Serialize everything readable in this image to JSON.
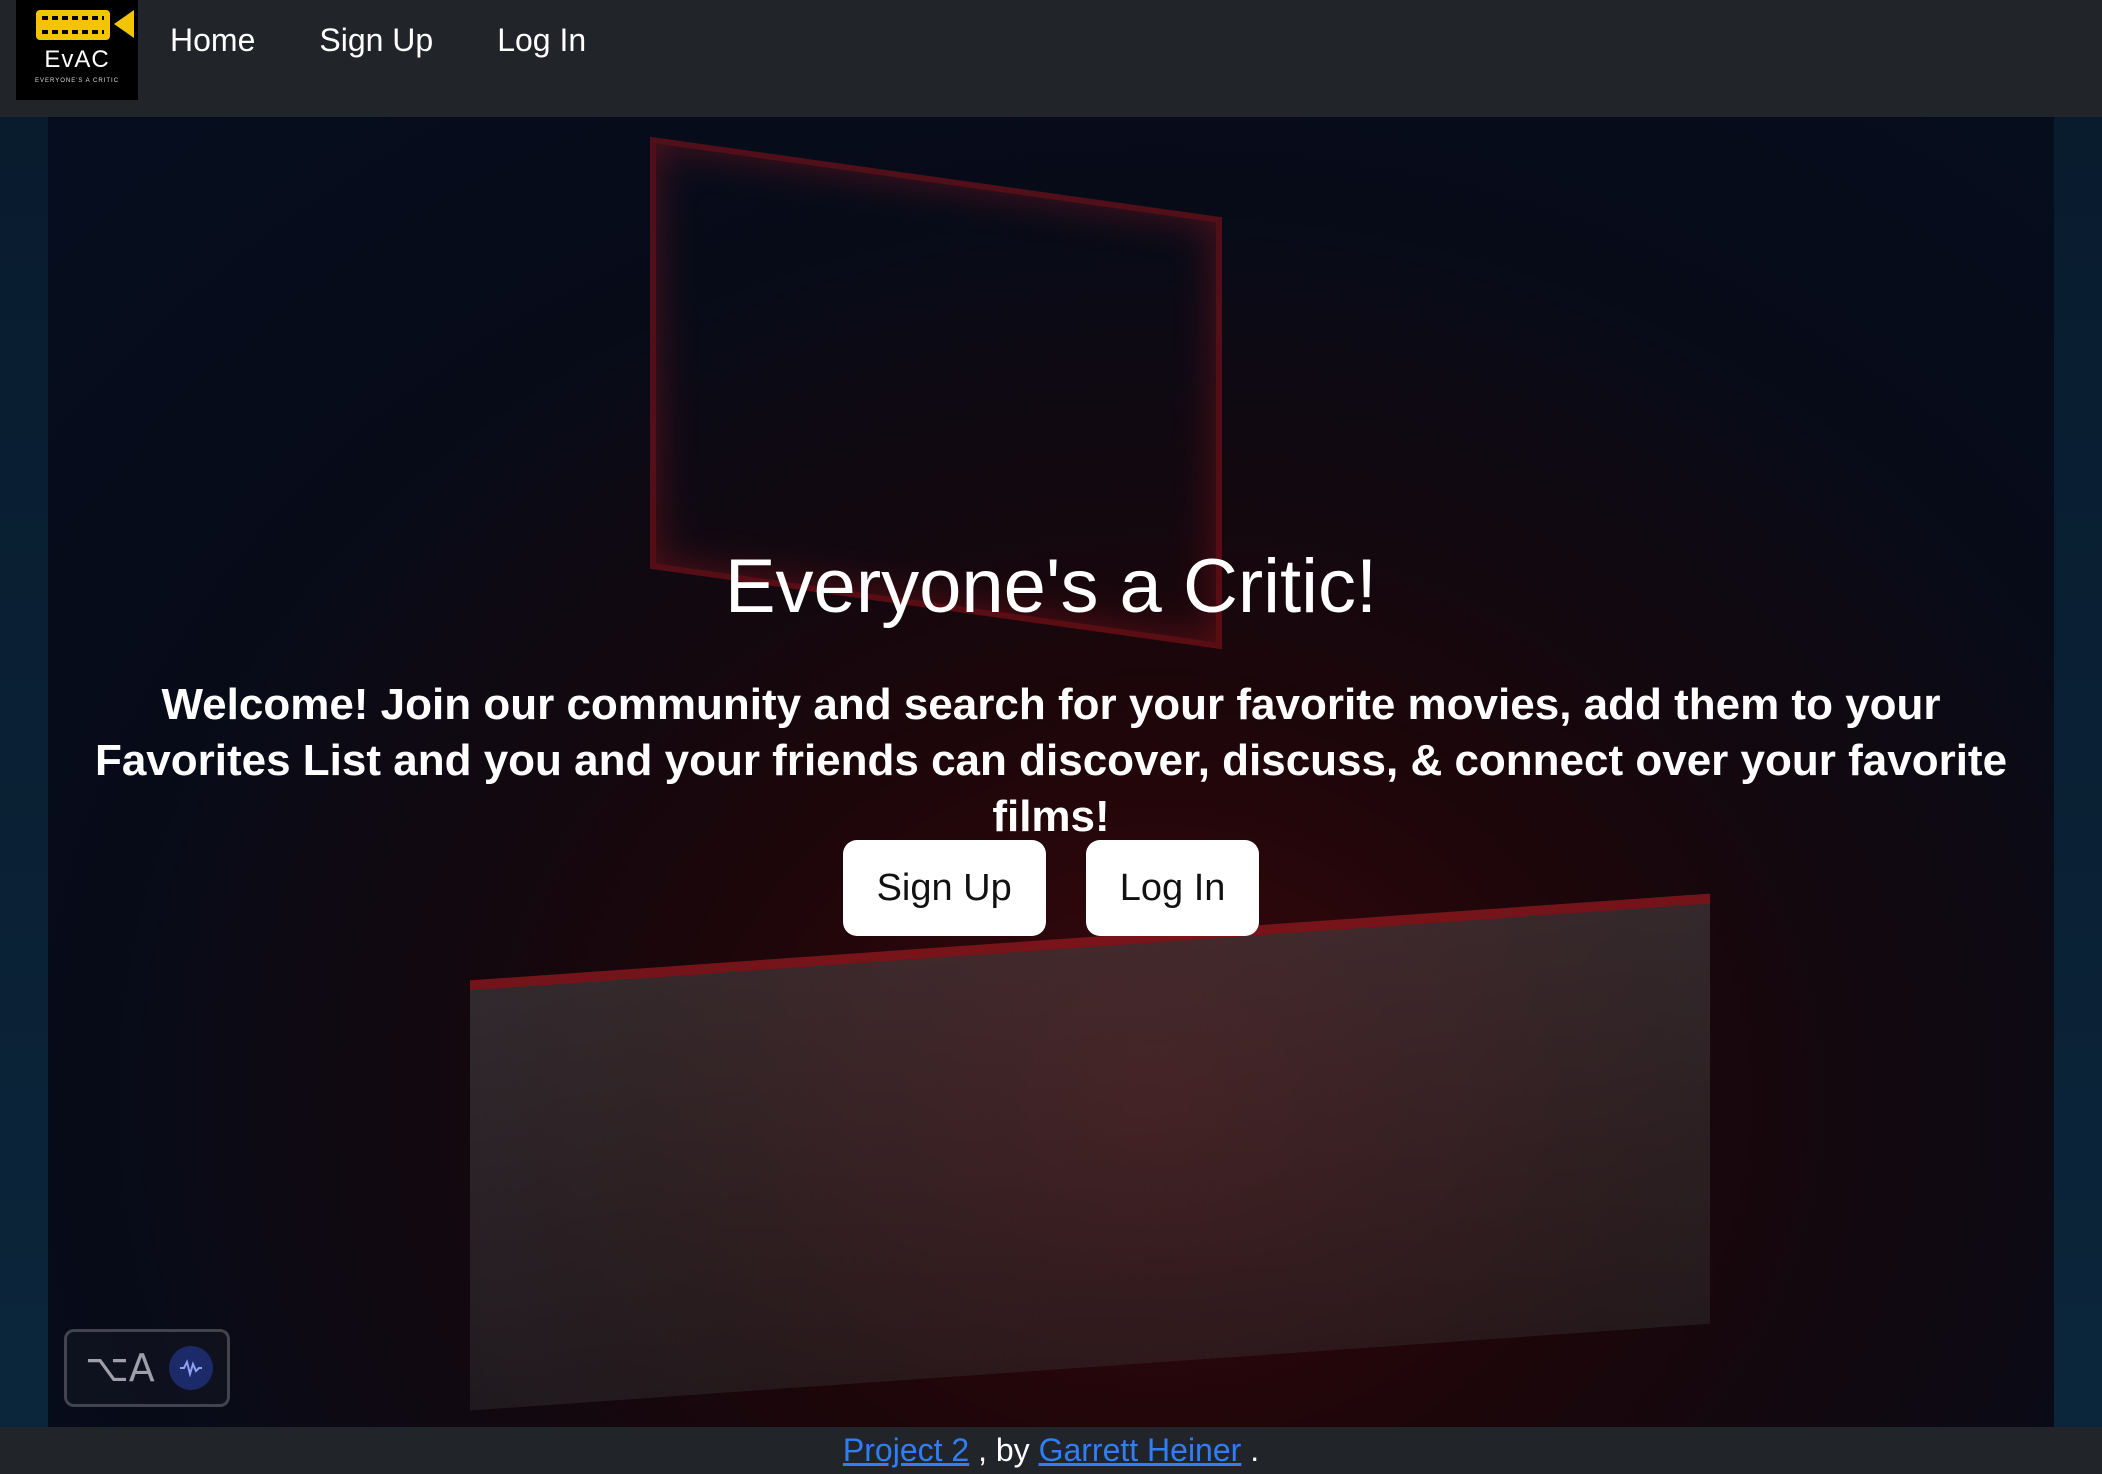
{
  "nav": {
    "logo_text": "EvAC",
    "logo_subtext": "EVERYONE'S A CRITIC",
    "items": [
      {
        "label": "Home"
      },
      {
        "label": "Sign Up"
      },
      {
        "label": "Log In"
      }
    ]
  },
  "hero": {
    "title": "Everyone's a Critic!",
    "text": "Welcome! Join our community and search for your favorite movies, add them to your Favorites List and you and your friends can discover, discuss, & connect over your favorite films!",
    "buttons": {
      "signup_label": "Sign Up",
      "login_label": "Log In"
    },
    "background_image": "fairfax-theater-marquee"
  },
  "widget": {
    "glyph": "⌥A",
    "wave_icon": "audio-wave-icon"
  },
  "footer": {
    "project_link": "Project 2",
    "separator": ", by",
    "author_link": "Garrett Heiner",
    "end": "."
  },
  "colors": {
    "nav_bg": "#212529",
    "link_blue": "#2f7ef6",
    "button_bg": "#ffffff"
  }
}
